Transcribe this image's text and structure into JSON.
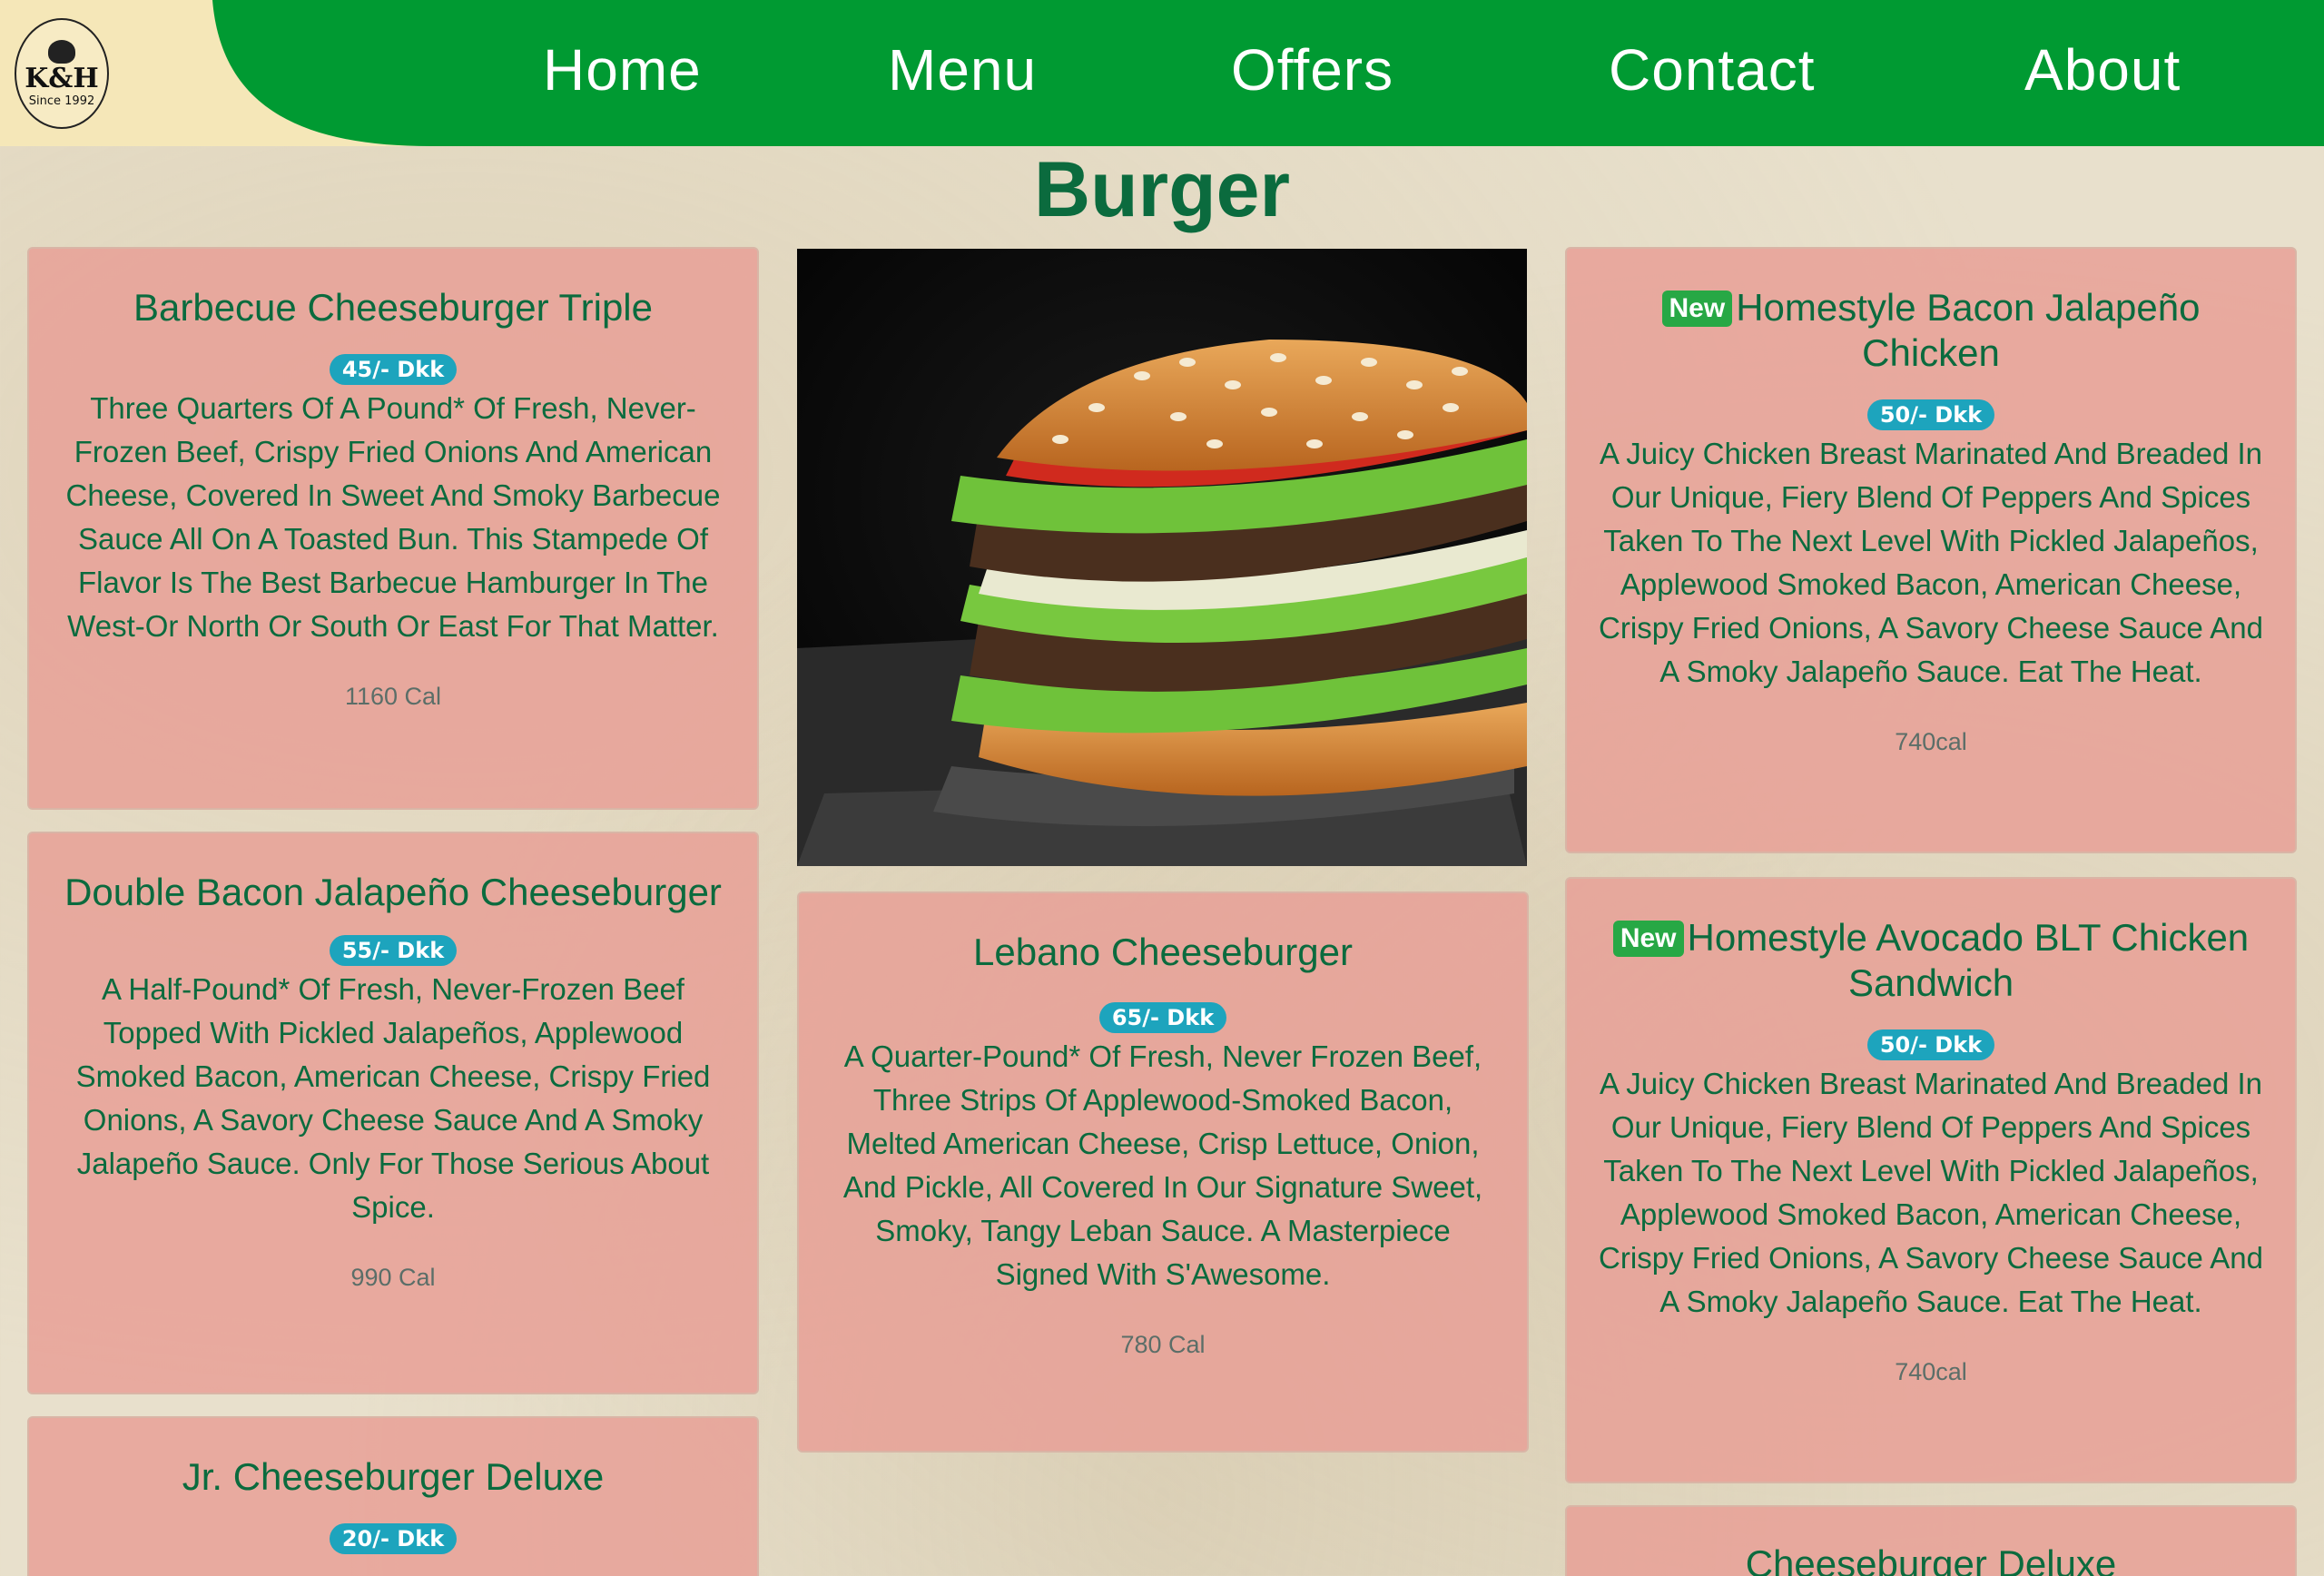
{
  "logo": {
    "brand": "K&H",
    "since": "Since 1992"
  },
  "nav": {
    "home": "Home",
    "menu": "Menu",
    "offers": "Offers",
    "contact": "Contact",
    "about": "About"
  },
  "page": {
    "title": "Burger"
  },
  "items": [
    {
      "title": "Barbecue Cheeseburger Triple",
      "price": "45/- Dkk",
      "description": "Three Quarters Of A Pound* Of Fresh, Never-Frozen Beef, Crispy Fried Onions And American Cheese, Covered In Sweet And Smoky Barbecue Sauce All On A Toasted Bun. This Stampede Of Flavor Is The Best Barbecue Hamburger In The West-Or North Or South Or East For That Matter.",
      "calories": "1160 Cal"
    },
    {
      "title": "Double Bacon Jalapeño Cheeseburger",
      "price": "55/- Dkk",
      "description": "A Half-Pound* Of Fresh, Never-Frozen Beef Topped With Pickled Jalapeños, Applewood Smoked Bacon, American Cheese, Crispy Fried Onions, A Savory Cheese Sauce And A Smoky Jalapeño Sauce. Only For Those Serious About Spice.",
      "calories": "990 Cal"
    },
    {
      "title": "Jr. Cheeseburger Deluxe",
      "price": "20/- Dkk",
      "description": "",
      "calories": ""
    },
    {
      "title": "Lebano Cheeseburger",
      "price": "65/- Dkk",
      "description": "A Quarter-Pound* Of Fresh, Never Frozen Beef, Three Strips Of Applewood-Smoked Bacon, Melted American Cheese, Crisp Lettuce, Onion, And Pickle, All Covered In Our Signature Sweet, Smoky, Tangy Leban Sauce. A Masterpiece Signed With S'Awesome.",
      "calories": "780 Cal"
    },
    {
      "badge": "New",
      "title": "Homestyle Bacon Jalapeño Chicken",
      "price": "50/- Dkk",
      "description": "A Juicy Chicken Breast Marinated And Breaded In Our Unique, Fiery Blend Of Peppers And Spices Taken To The Next Level With Pickled Jalapeños, Applewood Smoked Bacon, American Cheese, Crispy Fried Onions, A Savory Cheese Sauce And A Smoky Jalapeño Sauce. Eat The Heat.",
      "calories": "740cal"
    },
    {
      "badge": "New",
      "title": "Homestyle Avocado BLT Chicken Sandwich",
      "price": "50/- Dkk",
      "description": "A Juicy Chicken Breast Marinated And Breaded In Our Unique, Fiery Blend Of Peppers And Spices Taken To The Next Level With Pickled Jalapeños, Applewood Smoked Bacon, American Cheese, Crispy Fried Onions, A Savory Cheese Sauce And A Smoky Jalapeño Sauce. Eat The Heat.",
      "calories": "740cal"
    },
    {
      "title": "Cheeseburger Deluxe",
      "price": "",
      "description": "",
      "calories": ""
    }
  ]
}
